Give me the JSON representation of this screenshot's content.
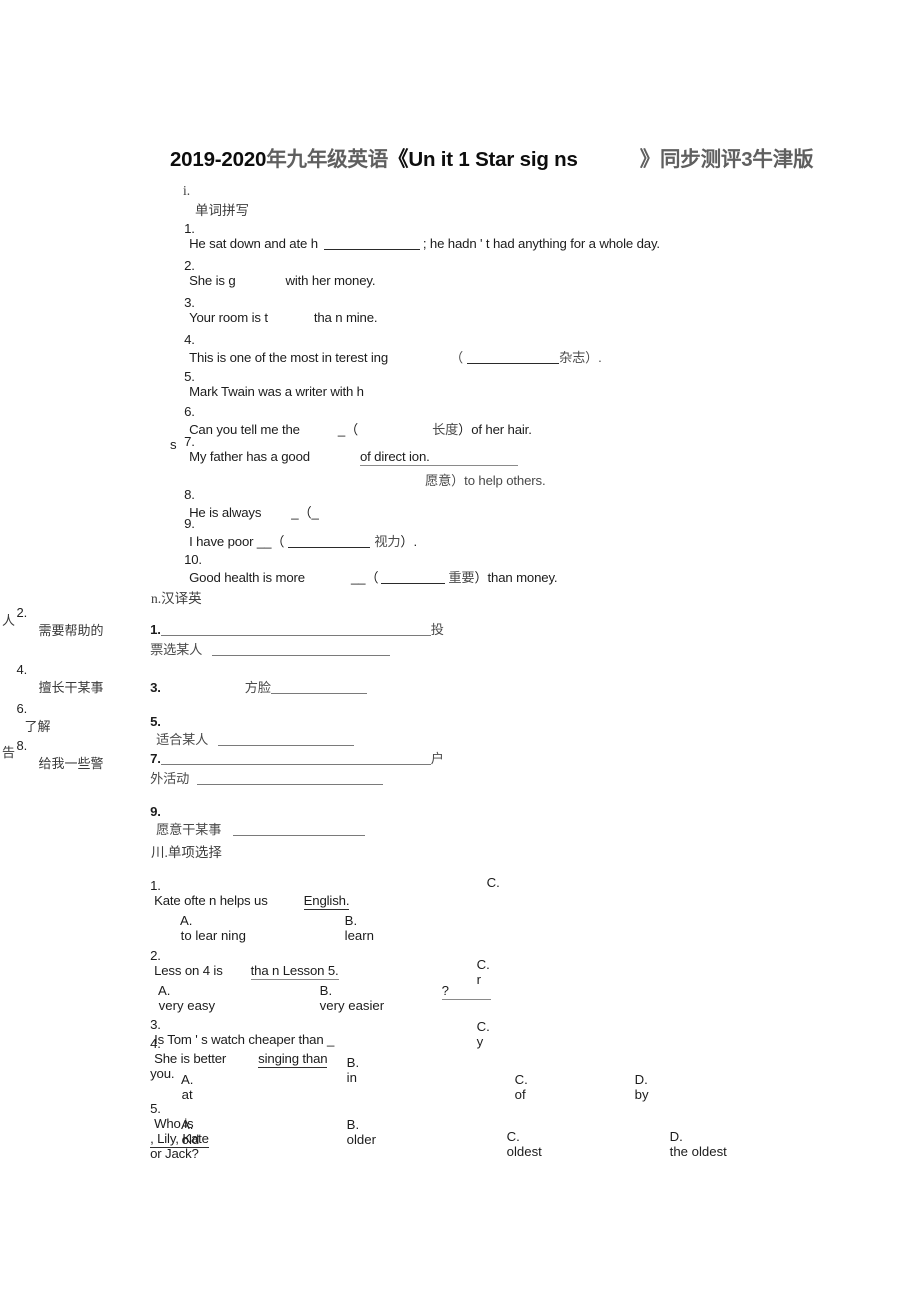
{
  "document": {
    "title_year": "2019-2020",
    "title_cjk1": "年九年级英语",
    "title_open": "《Un it 1 Star sig ns",
    "title_close": "》同步测评3牛津版"
  },
  "section1": {
    "marker": "i.",
    "heading": "单词拼写",
    "items": [
      {
        "num": "1.",
        "text_before": "He sat down and ate h",
        "text_after": "; he hadn ' t had anything for a whole day."
      },
      {
        "num": "2.",
        "text_before": "She is g",
        "text_after": "with her money."
      },
      {
        "num": "3.",
        "text_before": "Your room is t",
        "text_after": "tha n mine."
      },
      {
        "num": "4.",
        "text_before": "This is one of the most in terest ing",
        "paren_open": "（",
        "cjk": "杂志",
        "paren_close": "）.",
        "text_after": ""
      },
      {
        "num": "5.",
        "text_before": "Mark Twain was a writer with h",
        "text_after": ""
      },
      {
        "num": "6.",
        "text_before": "Can you tell me the",
        "mid": "_（",
        "cjk": "长度",
        "text_after": "）of her hair."
      },
      {
        "num": "7.",
        "text_before": "My father has a good",
        "underlined": "of direct ion.",
        "orphan": "s"
      },
      {
        "num": "8.",
        "text_before": "He is always",
        "mid": "_（_",
        "cjk_line": "愿意）to help others."
      },
      {
        "num": "9.",
        "text_before": "I have poor __（",
        "cjk": "视力",
        "text_after": "）."
      },
      {
        "num": "10.",
        "text_before": "Good health is more",
        "mid": "__（",
        "cjk": "重要",
        "text_after": "）than money."
      }
    ]
  },
  "margin_column": {
    "items": [
      {
        "num": "2.",
        "label": "需要帮助的",
        "wrap": "人"
      },
      {
        "num": "4.",
        "label": "擅长干某事",
        "wrap": ""
      },
      {
        "num": "6.",
        "label": "了解",
        "wrap": ""
      },
      {
        "num": "8.",
        "label": "给我一些警",
        "wrap": "告"
      }
    ]
  },
  "section2": {
    "marker": "n.",
    "heading": "汉译英",
    "items": [
      {
        "num": "1.",
        "tail_cjk": "投",
        "wrap_cjk": "票选某人"
      },
      {
        "num": "3.",
        "label": "方脸"
      },
      {
        "num": "5.",
        "label": "适合某人"
      },
      {
        "num": "7.",
        "tail_cjk": "户",
        "wrap_cjk": "外活动"
      },
      {
        "num": "9.",
        "label": "愿意干某事"
      }
    ]
  },
  "section3": {
    "marker": "川.",
    "heading": "单项选择",
    "questions": [
      {
        "num": "1.",
        "stem_before": "Kate ofte n helps us",
        "stem_underlined": "English.",
        "options": [
          {
            "key": "A.",
            "text": "to lear ning"
          },
          {
            "key": "B.",
            "text": "learn"
          },
          {
            "key": "C.",
            "text": ""
          }
        ]
      },
      {
        "num": "2.",
        "stem_before": "Less on 4 is",
        "stem_underlined": "tha n Lesson 5.",
        "options": [
          {
            "key": "A.",
            "text": "very easy"
          },
          {
            "key": "B.",
            "text": "very easier"
          },
          {
            "key": "C.",
            "text": "r"
          }
        ],
        "stray_mark": "?"
      },
      {
        "num": "3.",
        "stem_before": "Is Tom ' s watch cheaper than _",
        "options": [
          {
            "key": "C.",
            "text": "y"
          }
        ]
      },
      {
        "num": "4.",
        "stem_before": "She is better",
        "stem_underlined": "singing than",
        "stem_after": "you.",
        "options": [
          {
            "key": "A.",
            "text": "at"
          },
          {
            "key": "B.",
            "text": "in"
          },
          {
            "key": "C.",
            "text": "of"
          },
          {
            "key": "D.",
            "text": "by"
          }
        ]
      },
      {
        "num": "5.",
        "stem_before": "Who is",
        "stem_underlined": ", Lily, Kate",
        "stem_after": "or Jack?",
        "options": [
          {
            "key": "A.",
            "text": "old"
          },
          {
            "key": "B.",
            "text": "older"
          },
          {
            "key": "C.",
            "text": "oldest"
          },
          {
            "key": "D.",
            "text": "the oldest"
          }
        ]
      }
    ]
  }
}
